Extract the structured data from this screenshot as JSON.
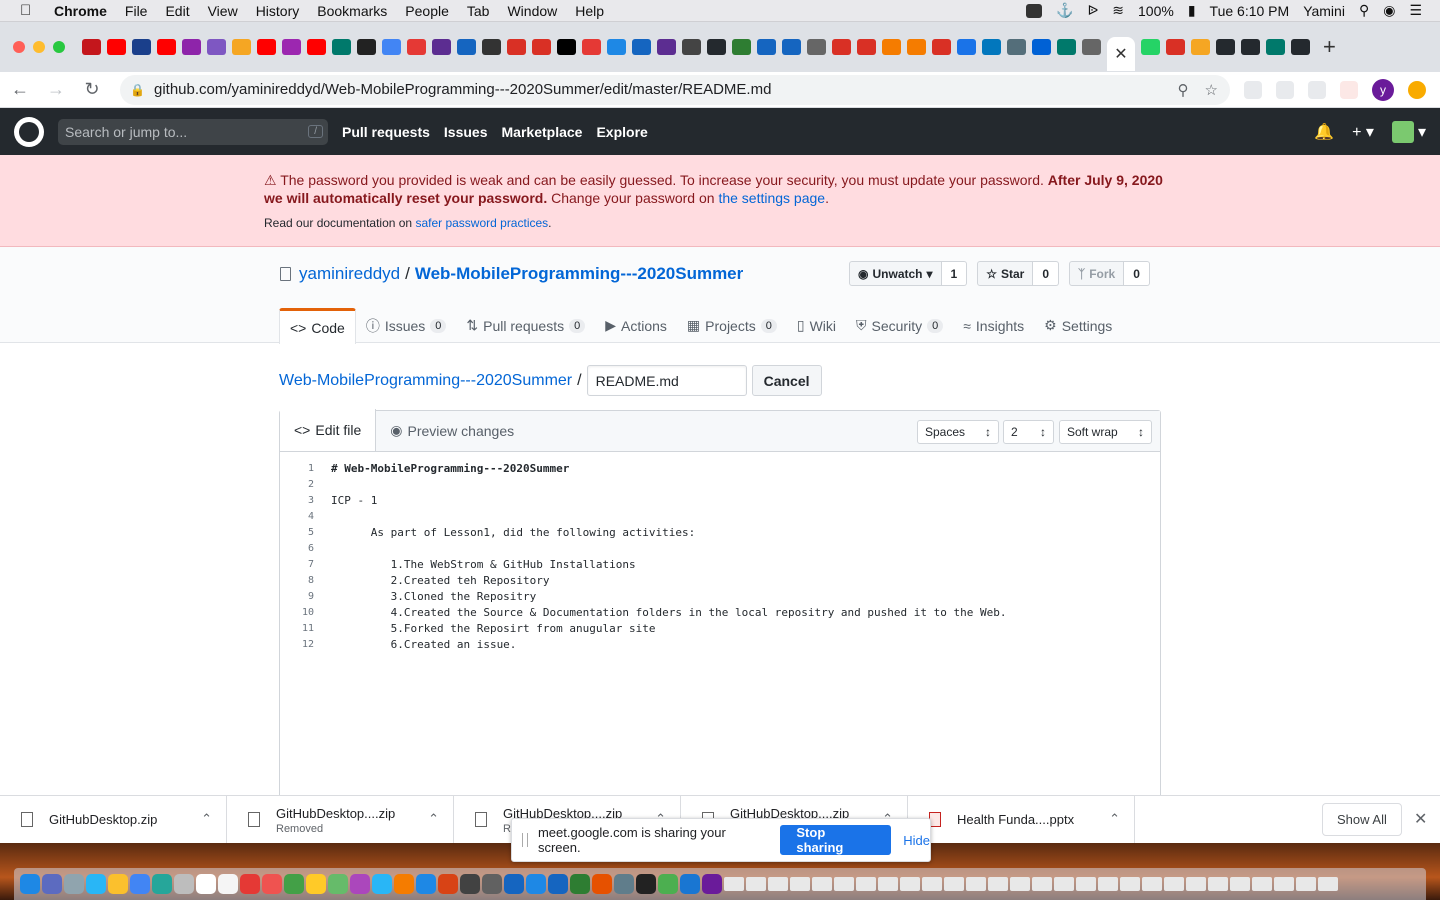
{
  "menubar": {
    "app": "Chrome",
    "items": [
      "File",
      "Edit",
      "View",
      "History",
      "Bookmarks",
      "People",
      "Tab",
      "Window",
      "Help"
    ],
    "battery": "100%",
    "clock": "Tue 6:10 PM",
    "user": "Yamini"
  },
  "browser": {
    "url": "github.com/yaminireddyd/Web-MobileProgramming---2020Summer/edit/master/README.md",
    "profile_initial": "y"
  },
  "github": {
    "search_placeholder": "Search or jump to...",
    "search_shortcut": "/",
    "nav": [
      "Pull requests",
      "Issues",
      "Marketplace",
      "Explore"
    ]
  },
  "flash": {
    "line1": "The password you provided is weak and can be easily guessed. To increase your security, you must update your password. ",
    "line1_bold": "After July 9, 2020 we will automatically reset your password.",
    "line1_end": " Change your password on ",
    "settings_link": "the settings page",
    "period": ".",
    "line2": "Read our documentation on ",
    "docs_link": "safer password practices",
    "line2_end": "."
  },
  "repo": {
    "owner": "yaminireddyd",
    "separator": "/",
    "name": "Web-MobileProgramming---2020Summer",
    "unwatch_label": "Unwatch",
    "watch_count": "1",
    "star_label": "Star",
    "star_count": "0",
    "fork_label": "Fork",
    "fork_count": "0",
    "tabs": [
      {
        "label": "Code"
      },
      {
        "label": "Issues",
        "count": "0"
      },
      {
        "label": "Pull requests",
        "count": "0"
      },
      {
        "label": "Actions"
      },
      {
        "label": "Projects",
        "count": "0"
      },
      {
        "label": "Wiki"
      },
      {
        "label": "Security",
        "count": "0"
      },
      {
        "label": "Insights"
      },
      {
        "label": "Settings"
      }
    ]
  },
  "editor": {
    "breadcrumb_repo": "Web-MobileProgramming---2020Summer",
    "breadcrumb_sep": "/",
    "filename": "README.md",
    "cancel_label": "Cancel",
    "tab_edit": "Edit file",
    "tab_preview": "Preview changes",
    "indent_mode": "Spaces",
    "indent_size": "2",
    "wrap_mode": "Soft wrap",
    "lines": [
      "# Web-MobileProgramming---2020Summer",
      "",
      "ICP - 1",
      "",
      "      As part of Lesson1, did the following activities:",
      "",
      "         1.The WebStrom & GitHub Installations",
      "         2.Created teh Repository",
      "         3.Cloned the Repositry",
      "         4.Created the Source & Documentation folders in the local repositry and pushed it to the Web.",
      "         5.Forked the Reposirt from anugular site",
      "         6.Created an issue."
    ]
  },
  "downloads": {
    "items": [
      {
        "name": "GitHubDesktop.zip",
        "sub": ""
      },
      {
        "name": "GitHubDesktop....zip",
        "sub": "Removed"
      },
      {
        "name": "GitHubDesktop....zip",
        "sub": "R"
      },
      {
        "name": "GitHubDesktop....zip",
        "sub": ""
      },
      {
        "name": "Health Funda....pptx",
        "sub": ""
      }
    ],
    "show_all": "Show All"
  },
  "share": {
    "message": "meet.google.com is sharing your screen.",
    "stop_label": "Stop sharing",
    "hide_label": "Hide"
  },
  "colors": {
    "github_header": "#24292e",
    "flash_bg": "#ffdce0",
    "link": "#0366d6",
    "active_tab_accent": "#e36209",
    "share_button": "#1a73e8"
  }
}
